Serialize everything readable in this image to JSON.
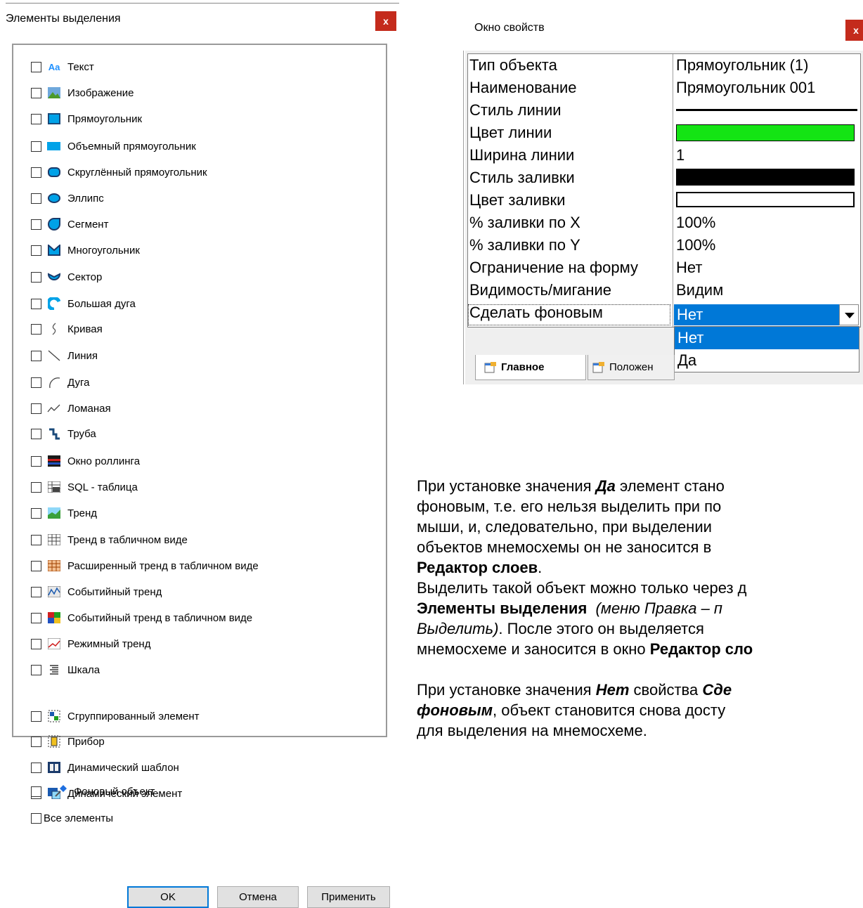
{
  "selection_dialog": {
    "title": "Элементы выделения",
    "close_label": "x",
    "items": [
      {
        "label": "Текст",
        "icon": "text-icon"
      },
      {
        "label": "Изображение",
        "icon": "image-icon"
      },
      {
        "label": "Прямоугольник",
        "icon": "rectangle-icon"
      },
      {
        "label": "Объемный прямоугольник",
        "icon": "3d-rectangle-icon"
      },
      {
        "label": "Скруглённый прямоугольник",
        "icon": "rounded-rectangle-icon"
      },
      {
        "label": "Эллипс",
        "icon": "ellipse-icon"
      },
      {
        "label": "Сегмент",
        "icon": "segment-icon"
      },
      {
        "label": "Многоугольник",
        "icon": "polygon-icon"
      },
      {
        "label": "Сектор",
        "icon": "sector-icon"
      },
      {
        "label": "Большая дуга",
        "icon": "big-arc-icon"
      },
      {
        "label": "Кривая",
        "icon": "curve-icon"
      },
      {
        "label": "Линия",
        "icon": "line-icon"
      },
      {
        "label": "Дуга",
        "icon": "arc-icon"
      },
      {
        "label": "Ломаная",
        "icon": "polyline-icon"
      },
      {
        "label": "Труба",
        "icon": "pipe-icon"
      },
      {
        "label": "Окно роллинга",
        "icon": "rolling-window-icon"
      },
      {
        "label": "SQL - таблица",
        "icon": "sql-table-icon"
      },
      {
        "label": "Тренд",
        "icon": "trend-icon"
      },
      {
        "label": "Тренд в табличном виде",
        "icon": "table-trend-icon"
      },
      {
        "label": "Расширенный тренд в табличном виде",
        "icon": "extended-table-trend-icon"
      },
      {
        "label": "Событийный тренд",
        "icon": "event-trend-icon"
      },
      {
        "label": "Событийный тренд в табличном виде",
        "icon": "event-table-trend-icon"
      },
      {
        "label": "Режимный тренд",
        "icon": "mode-trend-icon"
      },
      {
        "label": "Шкала",
        "icon": "scale-icon"
      },
      {
        "label": "Сгруппированный элемент",
        "icon": "grouped-element-icon"
      },
      {
        "label": "Прибор",
        "icon": "device-icon"
      },
      {
        "label": "Динамический шаблон",
        "icon": "dynamic-template-icon"
      },
      {
        "label": "Динамический элемент",
        "icon": "dynamic-element-icon"
      },
      {
        "label": "Фоновый объект",
        "icon": "pin-icon"
      }
    ],
    "all_elements_label": "Все элементы",
    "ok_label": "OK",
    "cancel_label": "Отмена",
    "apply_label": "Применить"
  },
  "properties_window": {
    "title": "Окно свойств",
    "close_label": "x",
    "rows": [
      {
        "name": "Тип объекта",
        "value": "Прямоугольник (1)"
      },
      {
        "name": "Наименование",
        "value": "Прямоугольник 001"
      },
      {
        "name": "Стиль линии",
        "value": ""
      },
      {
        "name": "Цвет линии",
        "value": ""
      },
      {
        "name": "Ширина линии",
        "value": "1"
      },
      {
        "name": "Стиль заливки",
        "value": ""
      },
      {
        "name": "Цвет заливки",
        "value": ""
      },
      {
        "name": "% заливки по X",
        "value": "100%"
      },
      {
        "name": "% заливки по Y",
        "value": "100%"
      },
      {
        "name": "Ограничение на форму",
        "value": "Нет"
      },
      {
        "name": "Видимость/мигание",
        "value": "Видим"
      },
      {
        "name": "Сделать фоновым",
        "value": "Нет"
      }
    ],
    "line_color": "#14e414",
    "fill_style_color": "#000000",
    "fill_color": "#ffffff",
    "dropdown_options": [
      "Нет",
      "Да"
    ],
    "tabs": [
      "Главное",
      "Положен"
    ]
  },
  "description": {
    "p1_l1_a": "При установке значения ",
    "p1_l1_b": "Да",
    "p1_l1_c": " элемент стано",
    "p1_l2": "фоновым, т.е. его нельзя выделить при по",
    "p1_l3": "мыши, и, следовательно, при выделении",
    "p1_l4": "объектов мнемосхемы он не заносится в",
    "p1_l5": "Редактор слоев",
    "p1_l5_end": ".",
    "p2_l1": "Выделить такой объект можно только через д",
    "p2_l2_a": "Элементы выделения",
    "p2_l2_b": "(меню Правка – п",
    "p2_l3_a": "Выделить)",
    "p2_l3_b": ". После этого он выделяется",
    "p2_l4_a": "мнемосхеме и заносится в окно ",
    "p2_l4_b": "Редактор сло",
    "p3_l1_a": "При установке значения ",
    "p3_l1_b": "Нет",
    "p3_l1_c": " свойства ",
    "p3_l1_d": "Сде",
    "p3_l2_a": "фоновым",
    "p3_l2_b": ", объект становится снова досту",
    "p3_l3": "для выделения на мнемосхеме."
  }
}
